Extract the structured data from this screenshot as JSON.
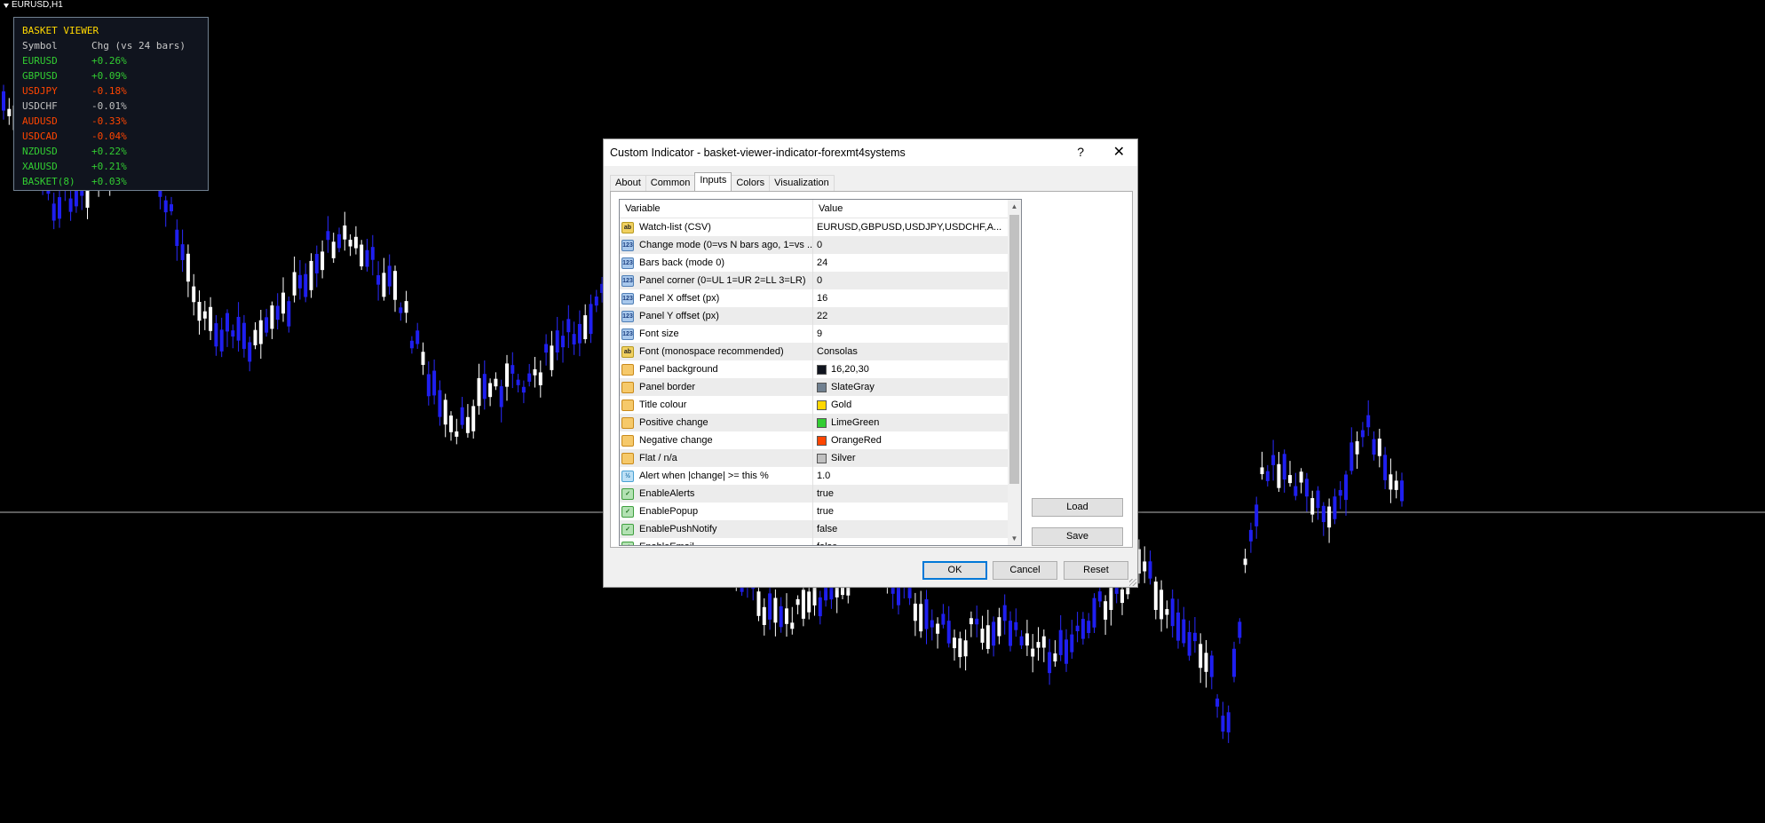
{
  "chart": {
    "symbol_label": "EURUSD,H1"
  },
  "basket_panel": {
    "title": "BASKET VIEWER",
    "header_symbol": "Symbol",
    "header_change": "Chg (vs 24 bars)",
    "rows": [
      {
        "symbol": "EURUSD",
        "change": "+0.26%",
        "color": "#32cd32"
      },
      {
        "symbol": "GBPUSD",
        "change": "+0.09%",
        "color": "#32cd32"
      },
      {
        "symbol": "USDJPY",
        "change": "-0.18%",
        "color": "#ff4500"
      },
      {
        "symbol": "USDCHF",
        "change": "-0.01%",
        "color": "#c0c0c0"
      },
      {
        "symbol": "AUDUSD",
        "change": "-0.33%",
        "color": "#ff4500"
      },
      {
        "symbol": "USDCAD",
        "change": "-0.04%",
        "color": "#ff4500"
      },
      {
        "symbol": "NZDUSD",
        "change": "+0.22%",
        "color": "#32cd32"
      },
      {
        "symbol": "XAUUSD",
        "change": "+0.21%",
        "color": "#32cd32"
      },
      {
        "symbol": "BASKET(8)",
        "change": "+0.03%",
        "color": "#32cd32"
      }
    ]
  },
  "dialog": {
    "title": "Custom Indicator - basket-viewer-indicator-forexmt4systems",
    "help": "?",
    "close": "✕",
    "tabs": [
      "About",
      "Common",
      "Inputs",
      "Colors",
      "Visualization"
    ],
    "active_tab": "Inputs",
    "columns": {
      "variable": "Variable",
      "value": "Value"
    },
    "rows": [
      {
        "icon": "str",
        "icon_text": "ab",
        "variable": "Watch-list (CSV)",
        "value": "EURUSD,GBPUSD,USDJPY,USDCHF,A..."
      },
      {
        "icon": "int",
        "icon_text": "123",
        "variable": "Change mode (0=vs N bars ago, 1=vs ...",
        "value": "0"
      },
      {
        "icon": "int",
        "icon_text": "123",
        "variable": "Bars back (mode 0)",
        "value": "24"
      },
      {
        "icon": "int",
        "icon_text": "123",
        "variable": "Panel corner (0=UL 1=UR 2=LL 3=LR)",
        "value": "0"
      },
      {
        "icon": "int",
        "icon_text": "123",
        "variable": "Panel X offset (px)",
        "value": "16"
      },
      {
        "icon": "int",
        "icon_text": "123",
        "variable": "Panel Y offset (px)",
        "value": "22"
      },
      {
        "icon": "int",
        "icon_text": "123",
        "variable": "Font size",
        "value": "9"
      },
      {
        "icon": "str",
        "icon_text": "ab",
        "variable": "Font (monospace recommended)",
        "value": "Consolas"
      },
      {
        "icon": "col",
        "icon_text": "",
        "variable": "Panel background",
        "value": "16,20,30",
        "swatch": "#10141e"
      },
      {
        "icon": "col",
        "icon_text": "",
        "variable": "Panel border",
        "value": "SlateGray",
        "swatch": "#708090"
      },
      {
        "icon": "col",
        "icon_text": "",
        "variable": "Title colour",
        "value": "Gold",
        "swatch": "#ffd700"
      },
      {
        "icon": "col",
        "icon_text": "",
        "variable": "Positive change",
        "value": "LimeGreen",
        "swatch": "#32cd32"
      },
      {
        "icon": "col",
        "icon_text": "",
        "variable": "Negative change",
        "value": "OrangeRed",
        "swatch": "#ff4500"
      },
      {
        "icon": "col",
        "icon_text": "",
        "variable": "Flat / n/a",
        "value": "Silver",
        "swatch": "#c0c0c0"
      },
      {
        "icon": "dbl",
        "icon_text": "½",
        "variable": "Alert when |change| >= this %",
        "value": "1.0"
      },
      {
        "icon": "bool",
        "icon_text": "✓",
        "variable": "EnableAlerts",
        "value": "true"
      },
      {
        "icon": "bool",
        "icon_text": "✓",
        "variable": "EnablePopup",
        "value": "true"
      },
      {
        "icon": "bool",
        "icon_text": "✓",
        "variable": "EnablePushNotify",
        "value": "false"
      },
      {
        "icon": "bool",
        "icon_text": "✓",
        "variable": "EnableEmail",
        "value": "false"
      }
    ],
    "buttons": {
      "load": "Load",
      "save": "Save",
      "ok": "OK",
      "cancel": "Cancel",
      "reset": "Reset"
    }
  }
}
